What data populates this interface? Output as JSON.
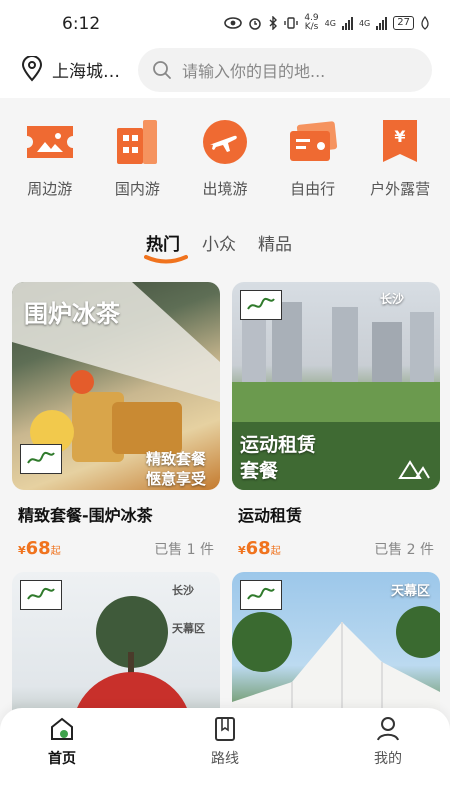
{
  "status": {
    "time": "6:12",
    "net_speed_value": "4.9",
    "net_speed_unit": "K/s",
    "signal1_label": "4G",
    "signal2_label": "4G",
    "battery": "27"
  },
  "header": {
    "city": "上海城…",
    "search_placeholder": "请输入你的目的地..."
  },
  "categories": [
    {
      "label": "周边游",
      "icon": "ticket-icon"
    },
    {
      "label": "国内游",
      "icon": "building-icon"
    },
    {
      "label": "出境游",
      "icon": "plane-icon"
    },
    {
      "label": "自由行",
      "icon": "card-icon"
    },
    {
      "label": "户外露营",
      "icon": "tag-icon"
    }
  ],
  "tabs": [
    {
      "label": "热门",
      "active": true
    },
    {
      "label": "小众",
      "active": false
    },
    {
      "label": "精品",
      "active": false
    }
  ],
  "cards": [
    {
      "title": "精致套餐-围炉冰茶",
      "price": "68",
      "price_suffix": "起",
      "sold": "已售 1 件",
      "overlay_title": "围炉冰茶",
      "overlay_caption1": "精致套餐",
      "overlay_caption2": "惬意享受"
    },
    {
      "title": "运动租赁",
      "price": "68",
      "price_suffix": "起",
      "sold": "已售 2 件",
      "overlay_title1": "运动租赁",
      "overlay_title2": "套餐",
      "overlay_corner": "长沙"
    },
    {
      "overlay_corner": "长沙",
      "overlay_sub": "天幕区"
    },
    {
      "overlay_corner": "天幕区"
    }
  ],
  "nav": [
    {
      "label": "首页",
      "icon": "home-icon",
      "active": true
    },
    {
      "label": "路线",
      "icon": "route-book-icon",
      "active": false
    },
    {
      "label": "我的",
      "icon": "profile-icon",
      "active": false
    }
  ],
  "colors": {
    "accent": "#f0731e",
    "card_accent": "#ef6a32"
  }
}
